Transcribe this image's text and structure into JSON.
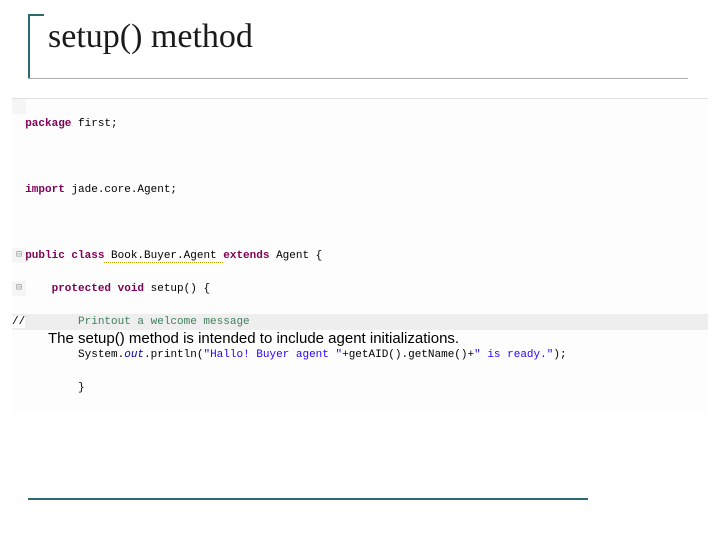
{
  "title": "setup() method",
  "code": {
    "l1a": "package",
    "l1b": " first;",
    "l2a": "import",
    "l2b": " jade.core.Agent;",
    "l3a": "public class",
    "l3b": " Book.Buyer.Agent ",
    "l3c": "extends",
    "l3d": " Agent {",
    "l4a": "    protected void",
    "l4b": " setup() {",
    "l5_prefix": "//",
    "l5": "        Printout a welcome message",
    "l6a": "        System.",
    "l6b": "out",
    "l6c": ".println(",
    "l6d": "\"Hallo! Buyer agent \"",
    "l6e": "+getAID().getName()+",
    "l6f": "\" is ready.\"",
    "l6g": ");",
    "l7": "        }"
  },
  "description": "The setup() method is intended to include agent initializations."
}
